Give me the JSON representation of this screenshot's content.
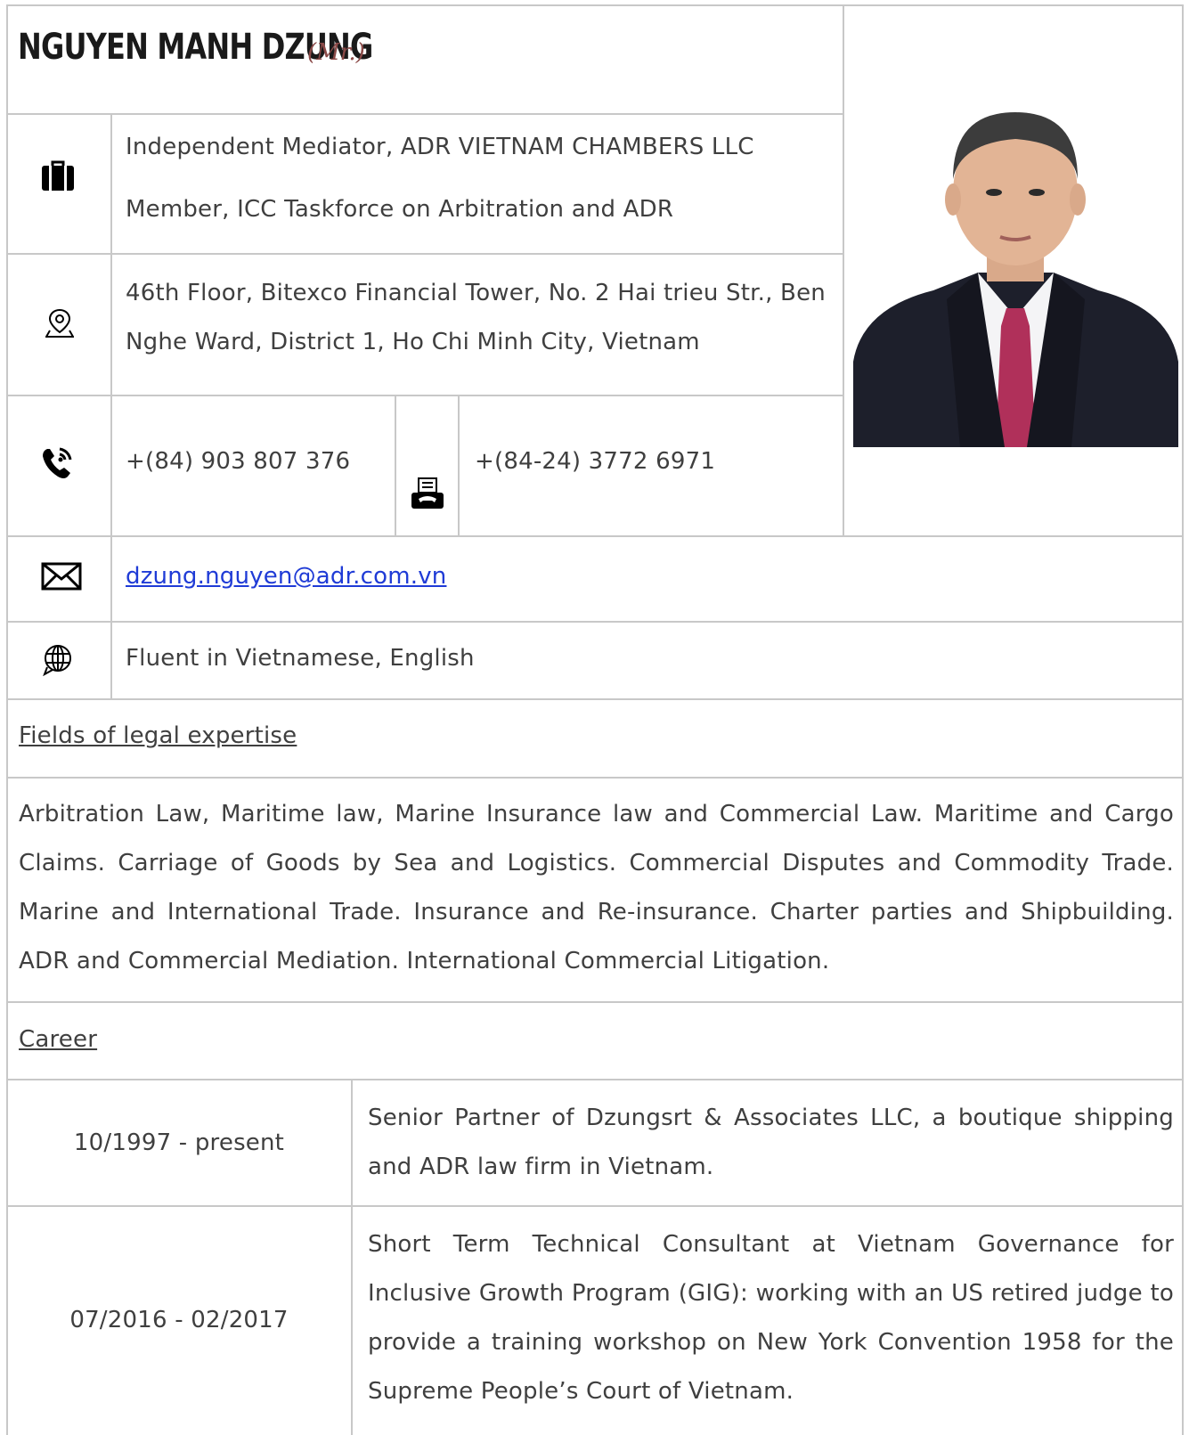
{
  "header": {
    "name": "NGUYEN MANH DZUNG",
    "honorific": "(Mr.)"
  },
  "positions": [
    "Independent Mediator, ADR VIETNAM CHAMBERS LLC",
    "Member, ICC Taskforce on Arbitration and ADR"
  ],
  "address": "46th Floor, Bitexco Financial Tower, No. 2 Hai trieu Str., Ben Nghe Ward, District 1, Ho Chi Minh City, Vietnam",
  "phone": "+(84) 903 807 376",
  "fax": "+(84-24) 3772 6971",
  "email": "dzung.nguyen@adr.com.vn",
  "languages": "Fluent in Vietnamese, English",
  "expertise": {
    "heading": "Fields of legal expertise",
    "text": "Arbitration Law, Maritime law, Marine Insurance law and Commercial Law. Maritime and Cargo Claims. Carriage of Goods by Sea and Logistics. Commercial Disputes and Commodity Trade. Marine and International Trade. Insurance and Re-insurance. Charter parties and Shipbuilding. ADR and Commercial Mediation. International Commercial Litigation."
  },
  "career": {
    "heading": "Career",
    "rows": [
      {
        "period": "10/1997 - present",
        "description": "Senior Partner of Dzungsrt & Associates LLC, a boutique shipping and ADR law firm in Vietnam."
      },
      {
        "period": "07/2016 - 02/2017",
        "description": "Short Term Technical Consultant at Vietnam Governance for Inclusive Growth Program (GIG): working with an US retired judge to provide a training workshop on New York Convention 1958 for the Supreme People’s Court of Vietnam."
      }
    ]
  },
  "icons": {
    "position": "briefcase-icon",
    "address": "map-pin-icon",
    "phone": "phone-ringing-icon",
    "fax": "fax-icon",
    "email": "envelope-icon",
    "language": "globe-chat-icon"
  },
  "colors": {
    "text": "#3f3f3f",
    "link": "#1f3bd6",
    "honorific": "#8b4a48",
    "border": "#c8c8c8"
  }
}
